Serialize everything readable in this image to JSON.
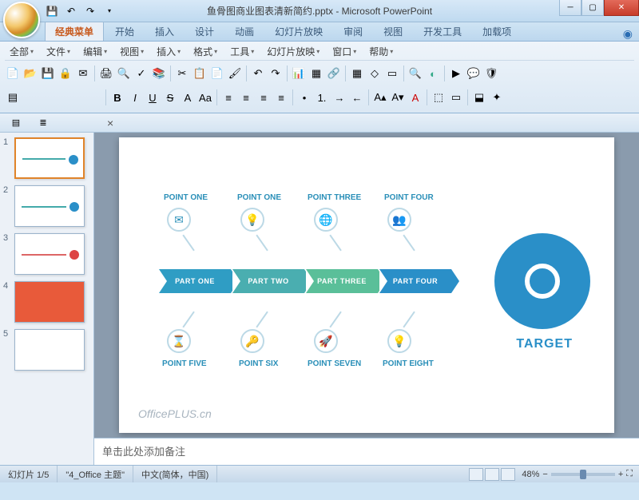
{
  "title": "鱼骨图商业图表清新简约.pptx - Microsoft PowerPoint",
  "ribbon_tabs": [
    "经典菜单",
    "开始",
    "插入",
    "设计",
    "动画",
    "幻灯片放映",
    "审阅",
    "视图",
    "开发工具",
    "加载项"
  ],
  "active_tab": 0,
  "menu_row": [
    "全部",
    "文件",
    "编辑",
    "视图",
    "插入",
    "格式",
    "工具",
    "幻灯片放映",
    "窗口",
    "帮助"
  ],
  "thumbnails": [
    1,
    2,
    3,
    4,
    5
  ],
  "selected_thumb": 1,
  "slide": {
    "top_points": [
      "POINT ONE",
      "POINT ONE",
      "POINT THREE",
      "POINT FOUR"
    ],
    "bottom_points": [
      "POINT FIVE",
      "POINT SIX",
      "POINT SEVEN",
      "POINT EIGHT"
    ],
    "chevrons": [
      "PART ONE",
      "PART TWO",
      "PART THREE",
      "PART FOUR"
    ],
    "target": "TARGET",
    "watermark": "OfficePLUS.cn"
  },
  "notes_placeholder": "单击此处添加备注",
  "status": {
    "slide_count": "幻灯片 1/5",
    "theme": "\"4_Office 主题\"",
    "lang": "中文(简体，中国)",
    "zoom": "48%"
  }
}
